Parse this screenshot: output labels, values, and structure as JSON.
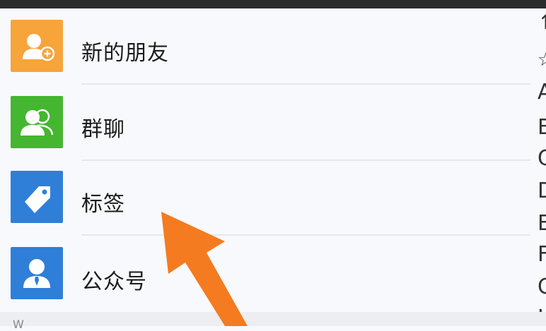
{
  "rows": [
    {
      "label": "新的朋友",
      "icon": "add-friend-icon",
      "color": "#f7a43a"
    },
    {
      "label": "群聊",
      "icon": "group-chat-icon",
      "color": "#45b62f"
    },
    {
      "label": "标签",
      "icon": "tag-icon",
      "color": "#2f7fd9"
    },
    {
      "label": "公众号",
      "icon": "official-account-icon",
      "color": "#2f7fd9"
    }
  ],
  "index_bar": {
    "top_symbol": "↑",
    "star": "☆",
    "letters": [
      "A",
      "B",
      "C",
      "D",
      "E",
      "F",
      "G",
      "H"
    ]
  },
  "section_header": "W",
  "annotation_arrow_color": "#f47b20"
}
